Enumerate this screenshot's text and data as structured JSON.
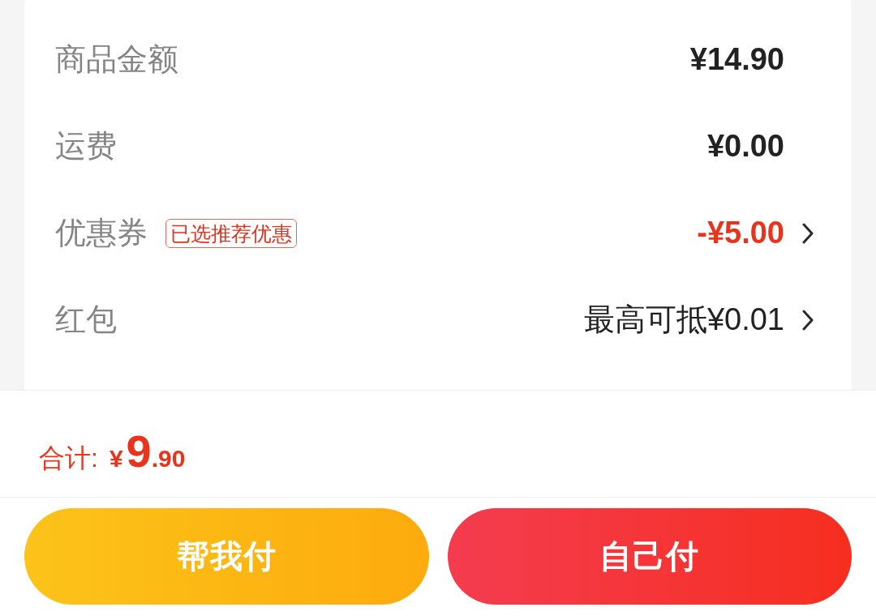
{
  "fee_rows": [
    {
      "kind": "amount",
      "label": "商品金额",
      "value": "¥14.90",
      "chevron": false
    },
    {
      "kind": "amount",
      "label": "运费",
      "value": "¥0.00",
      "chevron": false
    },
    {
      "kind": "discount",
      "label": "优惠券",
      "tag": "已选推荐优惠",
      "value": "-¥5.00",
      "chevron": true
    },
    {
      "kind": "offer",
      "label": "红包",
      "value": "最高可抵¥0.01",
      "chevron": true
    }
  ],
  "total": {
    "label": "合计:",
    "currency": "¥",
    "integer": "9",
    "fraction": ".90"
  },
  "buttons": [
    {
      "kind": "secondary",
      "label": "帮我付"
    },
    {
      "kind": "primary",
      "label": "自己付"
    }
  ]
}
